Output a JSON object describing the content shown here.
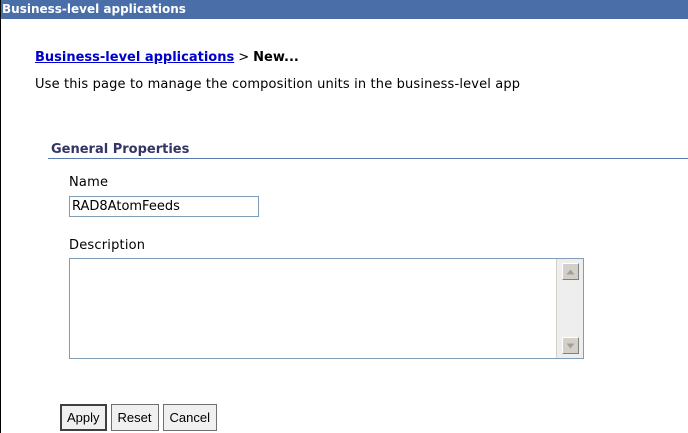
{
  "window": {
    "title": "Business-level applications"
  },
  "breadcrumb": {
    "link_label": "Business-level applications",
    "separator": ">",
    "current": "New..."
  },
  "intro_text": "Use this page to manage the composition units in the business-level app",
  "general_properties": {
    "title": "General Properties",
    "name_label": "Name",
    "name_value": "RAD8AtomFeeds",
    "description_label": "Description",
    "description_value": ""
  },
  "buttons": {
    "apply": "Apply",
    "reset": "Reset",
    "cancel": "Cancel"
  },
  "icons": {
    "scroll_up": "scroll-up-icon",
    "scroll_down": "scroll-down-icon"
  },
  "colors": {
    "titlebar": "#4a6ea8",
    "link": "#0000cc",
    "section_title": "#333366"
  }
}
